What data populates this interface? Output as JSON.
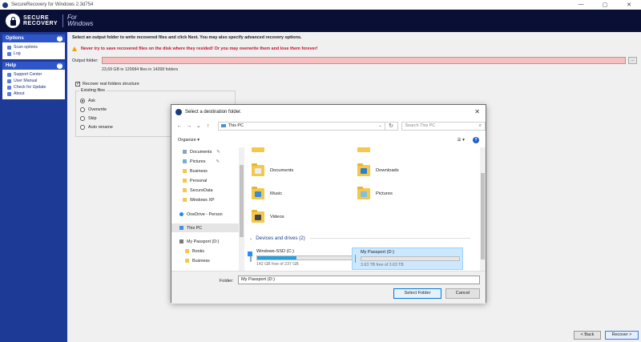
{
  "window": {
    "title": "SecureRecovery for Windows 2.3d754",
    "controls": [
      "—",
      "▢",
      "✕"
    ]
  },
  "brand": {
    "line1": "SECURE",
    "line2": "RECOVERY",
    "sub1": "For",
    "sub2": "Windows"
  },
  "sidebar": {
    "options": {
      "title": "Options",
      "items": [
        "Scan options",
        "Log"
      ]
    },
    "help": {
      "title": "Help",
      "items": [
        "Support Center",
        "User Manual",
        "Check for Update",
        "About"
      ]
    }
  },
  "main": {
    "instruction": "Select an output folder to write recovered files and click Next. You may also specify advanced recovery options.",
    "warning": "Never try to save recovered files on the disk where they resided! Or you may overwrite them and lose them forever!",
    "output_label": "Output folder:",
    "output_value": "",
    "browse_label": "...",
    "size_info": "23,69 GB in 120684 files in 14268 folders",
    "recover_structure_label": "Recover real folders structure",
    "recover_structure_checked": true,
    "existing_files": {
      "title": "Existing files",
      "options": [
        "Ask",
        "Overwrite",
        "Skip",
        "Auto rename"
      ],
      "selected": "Ask"
    },
    "back_label": "< Back",
    "recover_label": "Recover >"
  },
  "dialog": {
    "title": "Select a destination folder.",
    "close": "✕",
    "breadcrumb": "This PC",
    "search_placeholder": "Search This PC",
    "organize_label": "Organize ▾",
    "nav": [
      "Documents",
      "Pictures",
      "Business",
      "Personal",
      "SecureData",
      "Windows XP",
      "OneDrive - Person",
      "This PC",
      "My Passport (D:)",
      "Books",
      "Business"
    ],
    "folders": [
      "Documents",
      "Downloads",
      "Music",
      "Pictures",
      "Videos"
    ],
    "section_title": "Devices and drives (2)",
    "drives": [
      {
        "name": "Windows-SSD (C:)",
        "free": "142 GB free of 237 GB",
        "used_fraction": 0.4
      },
      {
        "name": "My Passport (D:)",
        "free": "3.63 TB free of 3.63 TB",
        "used_fraction": 0.0
      }
    ],
    "folder_label": "Folder:",
    "folder_value": "My Passport (D:)",
    "select_label": "Select Folder",
    "cancel_label": "Cancel"
  },
  "colors": {
    "banner": "#0a0f36",
    "sidebar": "#1d3a96",
    "warning": "#c8102e",
    "output_field": "#f7c0c0",
    "accent": "#0078d7"
  }
}
